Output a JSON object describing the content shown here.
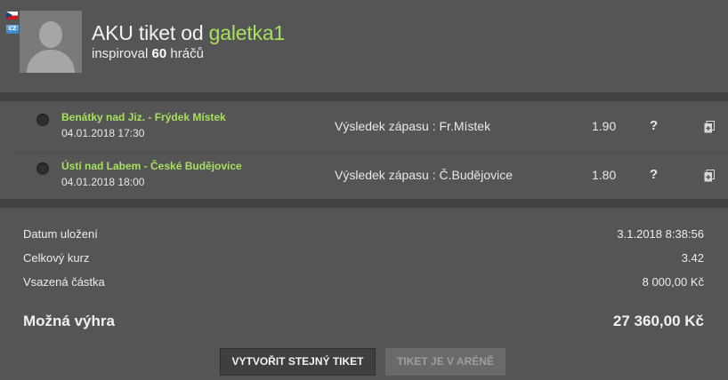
{
  "header": {
    "country_badge": "CZ",
    "title_prefix": "AKU tiket od",
    "username": "galetka1",
    "inspired_prefix": "inspiroval",
    "inspired_count": "60",
    "inspired_suffix": "hráčů"
  },
  "matches": [
    {
      "teams": "Benátky nad Jiz. - Frýdek Místek",
      "datetime": "04.01.2018 17:30",
      "result": "Výsledek zápasu : Fr.Místek",
      "odds": "1.90",
      "status": "?"
    },
    {
      "teams": "Ústí nad Labem - České Budějovice",
      "datetime": "04.01.2018 18:00",
      "result": "Výsledek zápasu : Č.Budějovice",
      "odds": "1.80",
      "status": "?"
    }
  ],
  "summary": {
    "saved_label": "Datum uložení",
    "saved_value": "3.1.2018 8:38:56",
    "total_odds_label": "Celkový kurz",
    "total_odds_value": "3.42",
    "stake_label": "Vsazená částka",
    "stake_value": "8 000,00 Kč",
    "win_label": "Možná výhra",
    "win_value": "27 360,00 Kč"
  },
  "actions": {
    "create_same": "VYTVOŘIT STEJNÝ TIKET",
    "in_arena": "TIKET JE V ARÉNĚ"
  },
  "colors": {
    "background": "#555555",
    "separator": "#434343",
    "accent_green": "#a8e05f"
  },
  "icons": {
    "flag": "czech-flag-icon",
    "avatar": "default-avatar-icon",
    "match_status": "dot-icon",
    "copy": "copy-ticket-icon"
  }
}
